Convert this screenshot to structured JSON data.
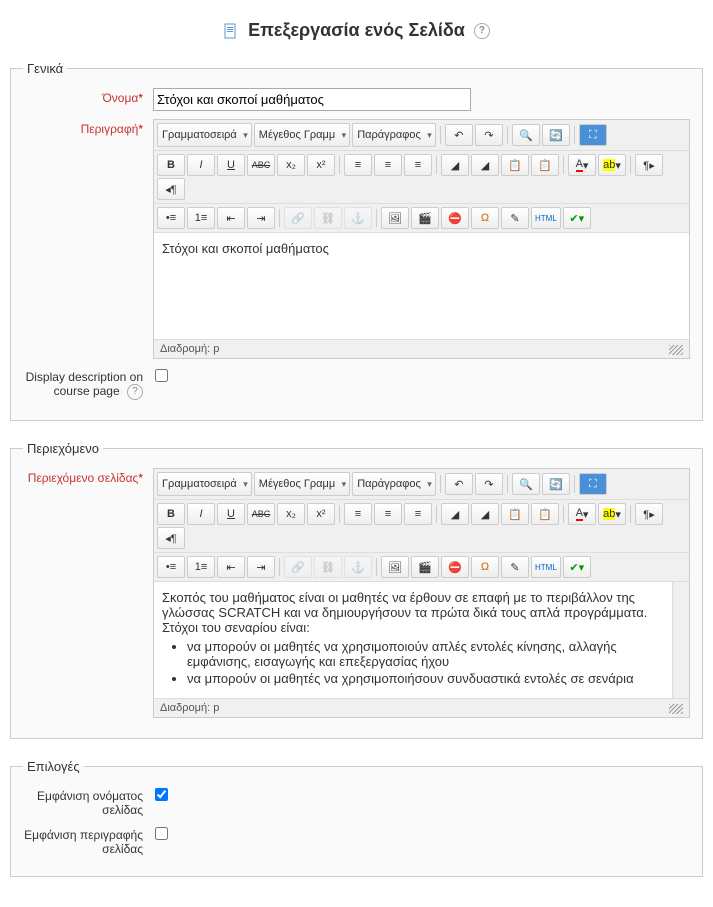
{
  "page": {
    "title": "Επεξεργασία ενός Σελίδα"
  },
  "general": {
    "legend": "Γενικά",
    "name_label": "Όνομα",
    "name_value": "Στόχοι και σκοποί μαθήματος",
    "desc_label": "Περιγραφή",
    "display_label": "Display description on course page",
    "editor": {
      "font_family": "Γραμματοσειρά",
      "font_size": "Μέγεθος Γραμμ",
      "format": "Παράγραφος",
      "content": "Στόχοι και σκοποί μαθήματος",
      "path_label": "Διαδρομή: p"
    }
  },
  "content_section": {
    "legend": "Περιεχόμενο",
    "content_label": "Περιεχόμενο σελίδας",
    "editor": {
      "font_family": "Γραμματοσειρά",
      "font_size": "Μέγεθος Γραμμ",
      "format": "Παράγραφος",
      "p1": "Σκοπός του μαθήματος είναι οι μαθητές να έρθουν σε επαφή με το περιβάλλον της γλώσσας SCRATCH και να δημιουργήσουν τα πρώτα δικά τους απλά προγράμματα.",
      "p2": "Στόχοι του σεναρίου είναι:",
      "li1": "να μπορούν οι μαθητές να χρησιμοποιούν απλές εντολές κίνησης, αλλαγής εμφάνισης, εισαγωγής και επεξεργασίας ήχου",
      "li2": "να μπορούν οι μαθητές να χρησιμοποιήσουν συνδυαστικά εντολές σε σενάρια",
      "path_label": "Διαδρομή: p"
    }
  },
  "options": {
    "legend": "Επιλογές",
    "display_name_label": "Εμφάνιση ονόματος σελίδας",
    "display_desc_label": "Εμφάνιση περιγραφής σελίδας"
  },
  "toolbar_icons": {
    "undo": "↶",
    "redo": "↷",
    "find": "🔍",
    "fullscreen": "⛶",
    "bold": "B",
    "italic": "I",
    "underline": "U",
    "strike": "ABC",
    "sub": "x₂",
    "sup": "x²",
    "align_l": "≡",
    "align_c": "≡",
    "align_r": "≡",
    "clean": "◢",
    "clean2": "◢",
    "paste": "📋",
    "paste2": "📋",
    "color": "A",
    "bg": "ab",
    "ltr": "¶▸",
    "rtl": "◂¶",
    "ul": "•≡",
    "ol": "1≡",
    "outdent": "⇤",
    "indent": "⇥",
    "link": "🔗",
    "unlink": "⛓",
    "anchor": "⚓",
    "img": "🖼",
    "media": "🎬",
    "nolink": "⛔",
    "omega": "Ω",
    "edit": "✎",
    "html": "HTML",
    "spell": "✔"
  }
}
